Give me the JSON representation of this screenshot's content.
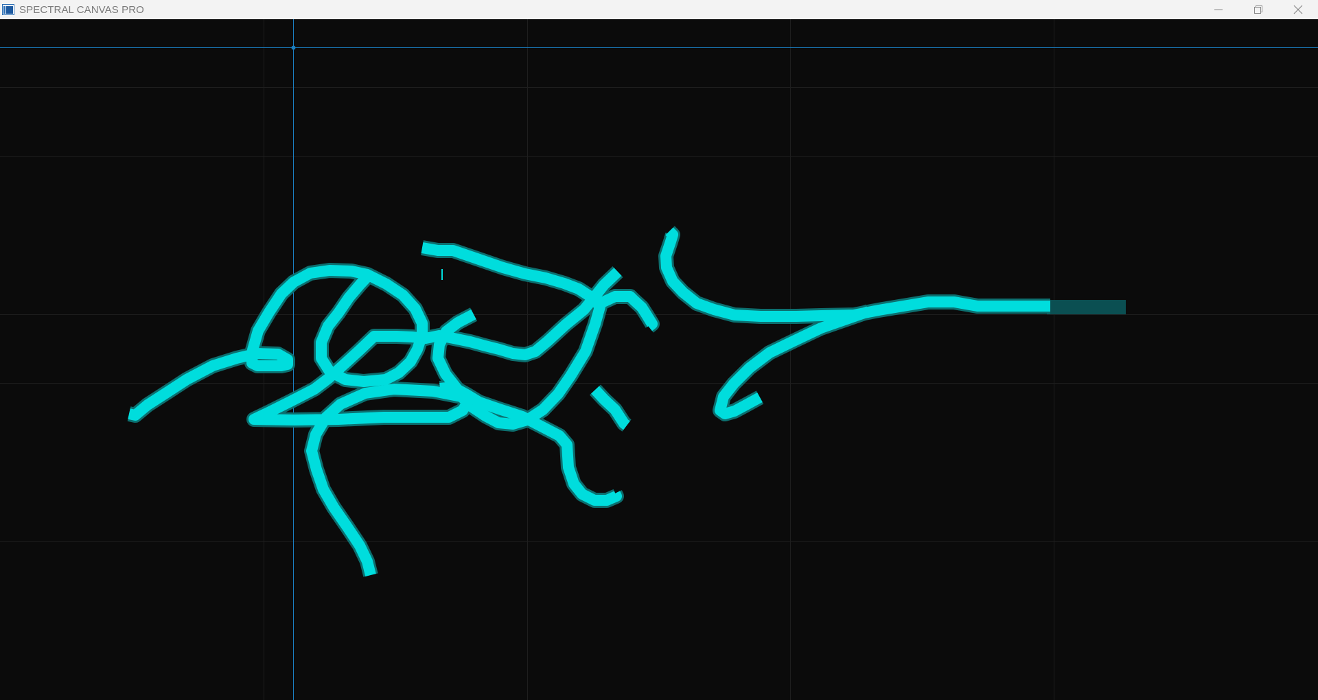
{
  "app": {
    "title": "SPECTRAL CANVAS PRO",
    "icon": "app-window-icon"
  },
  "window_controls": {
    "minimize_icon": "minimize-icon",
    "restore_icon": "restore-icon",
    "close_icon": "close-icon"
  },
  "canvas": {
    "background_color": "#0b0b0b",
    "grid_color": "#222222",
    "guide_color": "#1a7fc1",
    "stroke_color": "#00dddd",
    "stroke_outline_color": "#0c6f6f",
    "trailing_stroke_color": "#0b4f52"
  }
}
